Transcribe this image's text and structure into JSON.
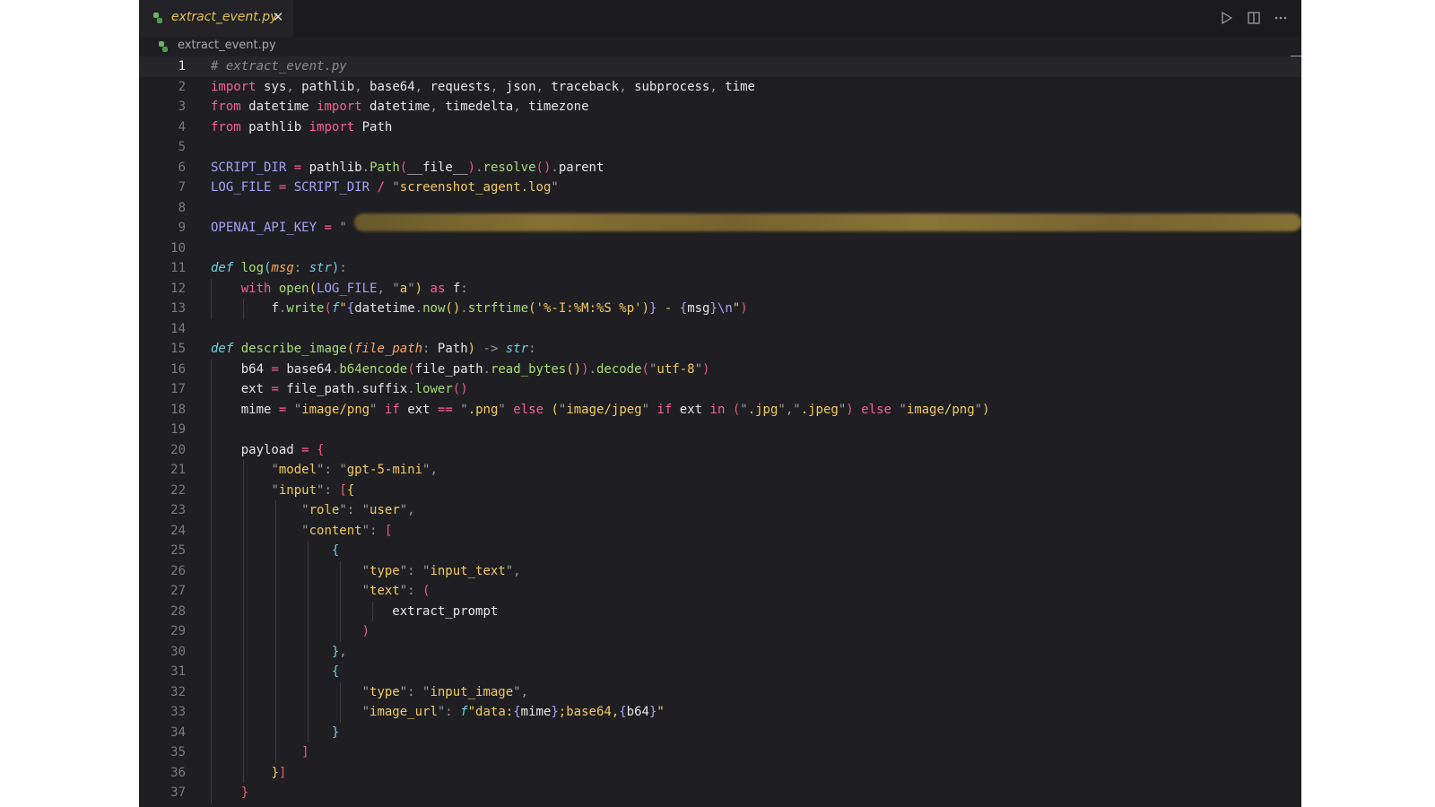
{
  "tab": {
    "title": "extract_event.py",
    "close_glyph": "✕"
  },
  "breadcrumb": {
    "file": "extract_event.py"
  },
  "toolbar": {
    "run_icon": "play-icon",
    "split_icon": "split-editor-icon",
    "more_icon": "more-icon"
  },
  "colors": {
    "keyword": "#f75f8f",
    "string": "#f1c95d",
    "function": "#a8dc76",
    "variable": "#a9a1f6",
    "tab_title": "#e2c04b",
    "background": "#1f1f23"
  },
  "code": {
    "line_numbers": [
      "1",
      "2",
      "3",
      "4",
      "5",
      "6",
      "7",
      "8",
      "9",
      "10",
      "11",
      "12",
      "13",
      "14",
      "15",
      "16",
      "17",
      "18",
      "19",
      "20",
      "21",
      "22",
      "23",
      "24",
      "25",
      "26",
      "27",
      "28",
      "29",
      "30",
      "31",
      "32",
      "33",
      "34",
      "35",
      "36",
      "37"
    ],
    "l1": "# extract_event.py",
    "l2": {
      "import": "import",
      "mods": [
        "sys",
        "pathlib",
        "base64",
        "requests",
        "json",
        "traceback",
        "subprocess",
        "time"
      ]
    },
    "l3": {
      "from": "from",
      "mod": "datetime",
      "import": "import",
      "names": [
        "datetime",
        "timedelta",
        "timezone"
      ]
    },
    "l4": {
      "from": "from",
      "mod": "pathlib",
      "import": "import",
      "name": "Path"
    },
    "l6": {
      "var": "SCRIPT_DIR",
      "obj": "pathlib",
      "fn": "Path",
      "arg": "__file__",
      "m1": "resolve",
      "attr": "parent"
    },
    "l7": {
      "var": "LOG_FILE",
      "base": "SCRIPT_DIR",
      "str": "screenshot_agent.log"
    },
    "l9": {
      "var": "OPENAI_API_KEY",
      "open": "\""
    },
    "l11": {
      "def": "def",
      "name": "log",
      "param": "msg",
      "type": "str"
    },
    "l12": {
      "with": "with",
      "fn": "open",
      "arg": "LOG_FILE",
      "mode": "a",
      "as": "as",
      "alias": "f"
    },
    "l13": {
      "obj": "f",
      "fn": "write",
      "prefix": "f",
      "a": "datetime",
      "b": "now",
      "c": "strftime",
      "fmt": "'%-I:%M:%S %p'",
      "dash": " - ",
      "msg": "msg",
      "nl": "\\n"
    },
    "l15": {
      "def": "def",
      "name": "describe_image",
      "param": "file_path",
      "ptype": "Path",
      "arrow": "->",
      "rtype": "str"
    },
    "l16": {
      "var": "b64",
      "obj": "base64",
      "fn": "b64encode",
      "arg": "file_path",
      "m1": "read_bytes",
      "m2": "decode",
      "enc": "utf-8"
    },
    "l17": {
      "var": "ext",
      "obj": "file_path",
      "attr": "suffix",
      "m": "lower"
    },
    "l18": {
      "var": "mime",
      "png": "image/png",
      "if": "if",
      "ext": "ext",
      "dotpng": ".png",
      "else": "else",
      "jpeg": "image/jpeg",
      "in": "in",
      "jpg": ".jpg",
      "jpeg2": ".jpeg",
      "png2": "image/png"
    },
    "l20": {
      "var": "payload"
    },
    "l21": {
      "key": "model",
      "val": "gpt-5-mini"
    },
    "l22": {
      "key": "input"
    },
    "l23": {
      "key": "role",
      "val": "user"
    },
    "l24": {
      "key": "content"
    },
    "l26": {
      "key": "type",
      "val": "input_text"
    },
    "l27": {
      "key": "text"
    },
    "l28": "extract_prompt",
    "l32": {
      "key": "type",
      "val": "input_image"
    },
    "l33": {
      "key": "image_url",
      "prefix": "f",
      "s1": "data:",
      "mime": "mime",
      "s2": ";base64,",
      "b64": "b64"
    }
  }
}
